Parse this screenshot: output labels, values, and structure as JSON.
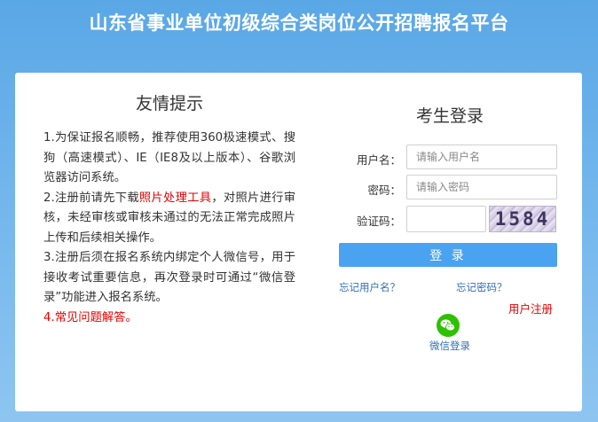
{
  "header": {
    "title": "山东省事业单位初级综合类岗位公开招聘报名平台"
  },
  "tips": {
    "title": "友情提示",
    "item1": "1.为保证报名顺畅，推荐使用360极速模式、搜狗（高速模式）、IE（IE8及以上版本）、谷歌浏览器访问系统。",
    "item2_prefix": "2.注册前请先下载",
    "item2_link": "照片处理工具",
    "item2_suffix": "，对照片进行审核，未经审核或审核未通过的无法正常完成照片上传和后续相关操作。",
    "item3": "3.注册后须在报名系统内绑定个人微信号，用于接收考试重要信息，再次登录时可通过“微信登录”功能进入报名系统。",
    "item4_prefix": "4.",
    "item4_link": "常见问题解答。"
  },
  "login": {
    "title": "考生登录",
    "username_label": "用户名：",
    "username_placeholder": "请输入用户名",
    "password_label": "密码：",
    "password_placeholder": "请输入密码",
    "captcha_label": "验证码：",
    "captcha_text": "1584",
    "submit_label": "登 录",
    "forgot_username": "忘记用户名？",
    "forgot_password": "忘记密码？",
    "register": "用户注册",
    "wechat_login": "微信登录",
    "wechat_icon": "wechat-icon",
    "wechat_color": "#2dc100",
    "button_color": "#4aa3f0"
  }
}
